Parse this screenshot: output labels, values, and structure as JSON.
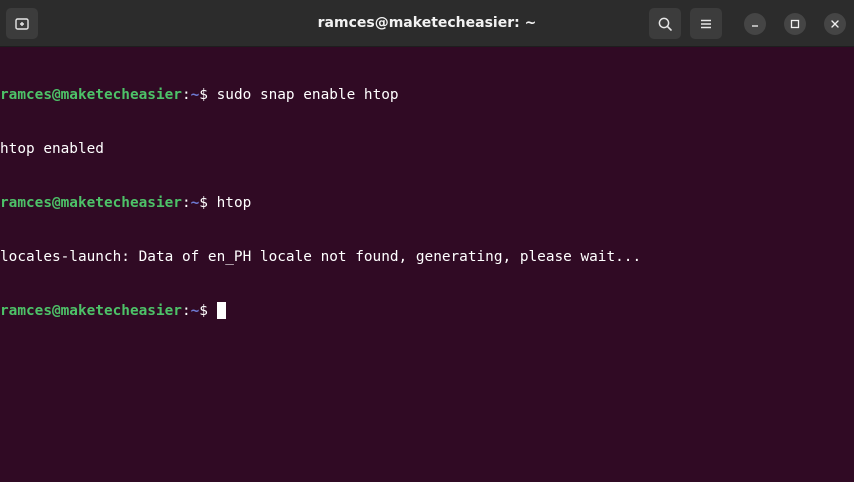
{
  "window": {
    "title": "ramces@maketecheasier: ~"
  },
  "header": {
    "new_tab_icon": "new-tab-icon",
    "search_icon": "search-icon",
    "menu_icon": "hamburger-menu-icon",
    "minimize_icon": "minimize-icon",
    "maximize_icon": "maximize-icon",
    "close_icon": "close-icon"
  },
  "colors": {
    "terminal_background": "#300a24",
    "prompt_user": "#4dc268",
    "prompt_path": "#6e7bd4",
    "text": "#ffffff",
    "titlebar": "#2c2c2c"
  },
  "terminal": {
    "lines": [
      {
        "user": "ramces@maketecheasier",
        "sep": ":",
        "path": "~",
        "dollar": "$ ",
        "cmd": "sudo snap enable htop"
      },
      {
        "output": "htop enabled"
      },
      {
        "user": "ramces@maketecheasier",
        "sep": ":",
        "path": "~",
        "dollar": "$ ",
        "cmd": "htop"
      },
      {
        "output": "locales-launch: Data of en_PH locale not found, generating, please wait..."
      },
      {
        "user": "ramces@maketecheasier",
        "sep": ":",
        "path": "~",
        "dollar": "$ ",
        "cmd": ""
      }
    ]
  }
}
